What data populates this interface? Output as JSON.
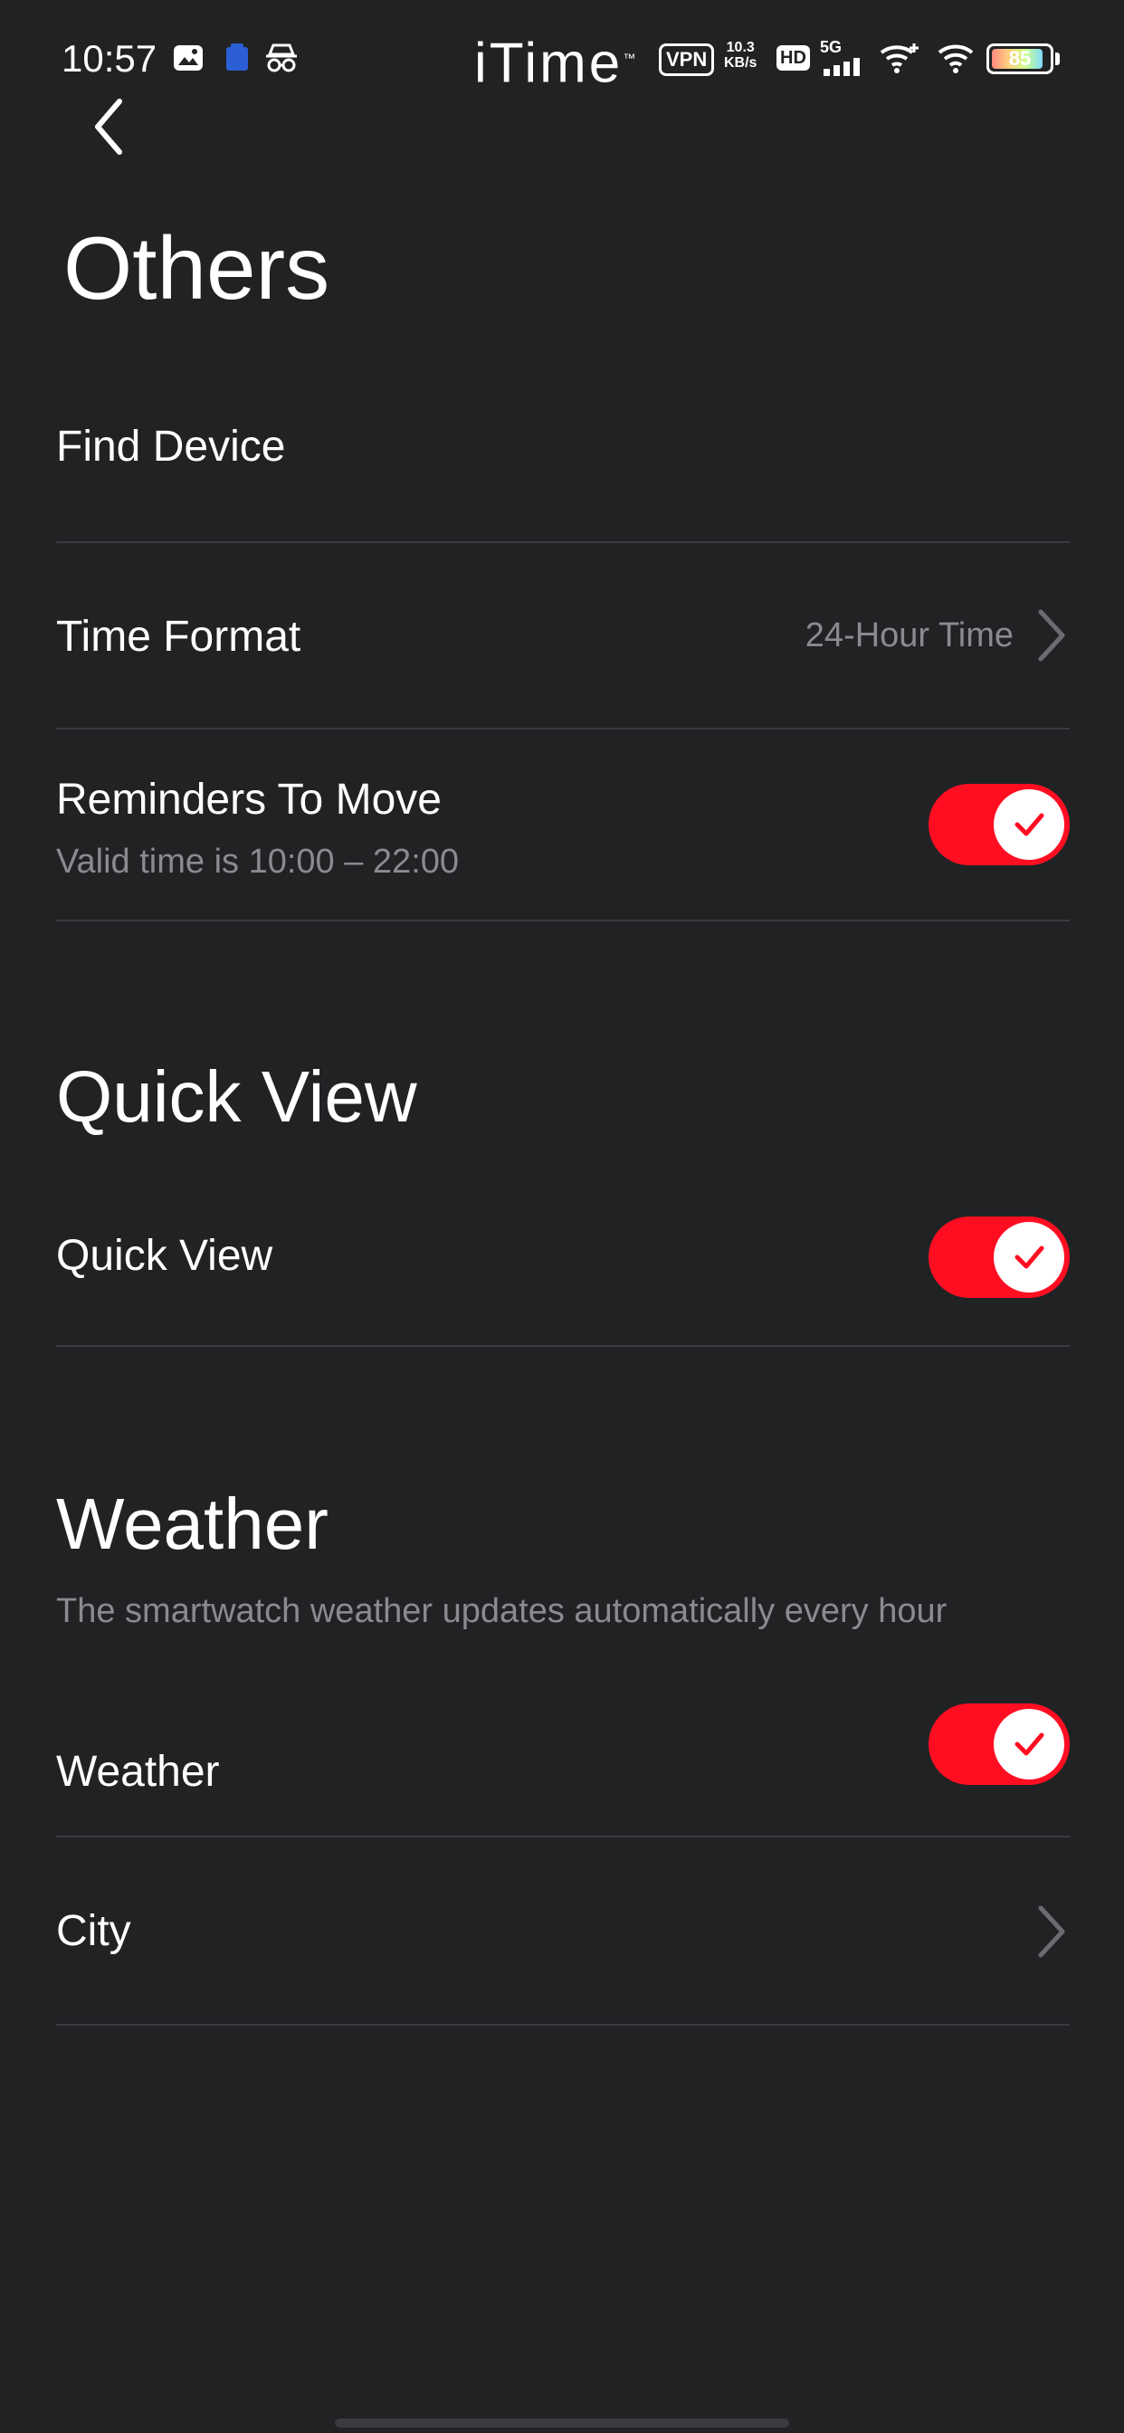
{
  "status_bar": {
    "time": "10:57",
    "brand": "iTime",
    "brand_tm": "™",
    "vpn": "VPN",
    "speed_value": "10.3",
    "speed_unit": "KB/s",
    "hd": "HD",
    "network": "5G",
    "battery": "85",
    "icons": [
      "gallery-icon",
      "app-notification-icon",
      "incognito-icon",
      "signal-bars-icon",
      "wifi-plus-icon",
      "wifi-icon",
      "battery-icon"
    ]
  },
  "header": {
    "back_icon": "chevron-left-icon",
    "title": "Others"
  },
  "others": {
    "find_device": "Find Device",
    "time_format_label": "Time Format",
    "time_format_value": "24-Hour Time",
    "reminders_label": "Reminders To Move",
    "reminders_sub": "Valid time is 10:00 – 22:00",
    "reminders_on": true
  },
  "quick_view": {
    "section_title": "Quick View",
    "label": "Quick View",
    "on": true
  },
  "weather": {
    "section_title": "Weather",
    "description": "The smartwatch weather updates automatically every hour",
    "label": "Weather",
    "on": true,
    "city_label": "City"
  },
  "colors": {
    "background": "#212224",
    "toggle_on": "#ff0e22",
    "divider": "#3a3b3e",
    "secondary_text": "#8a8b8e"
  }
}
